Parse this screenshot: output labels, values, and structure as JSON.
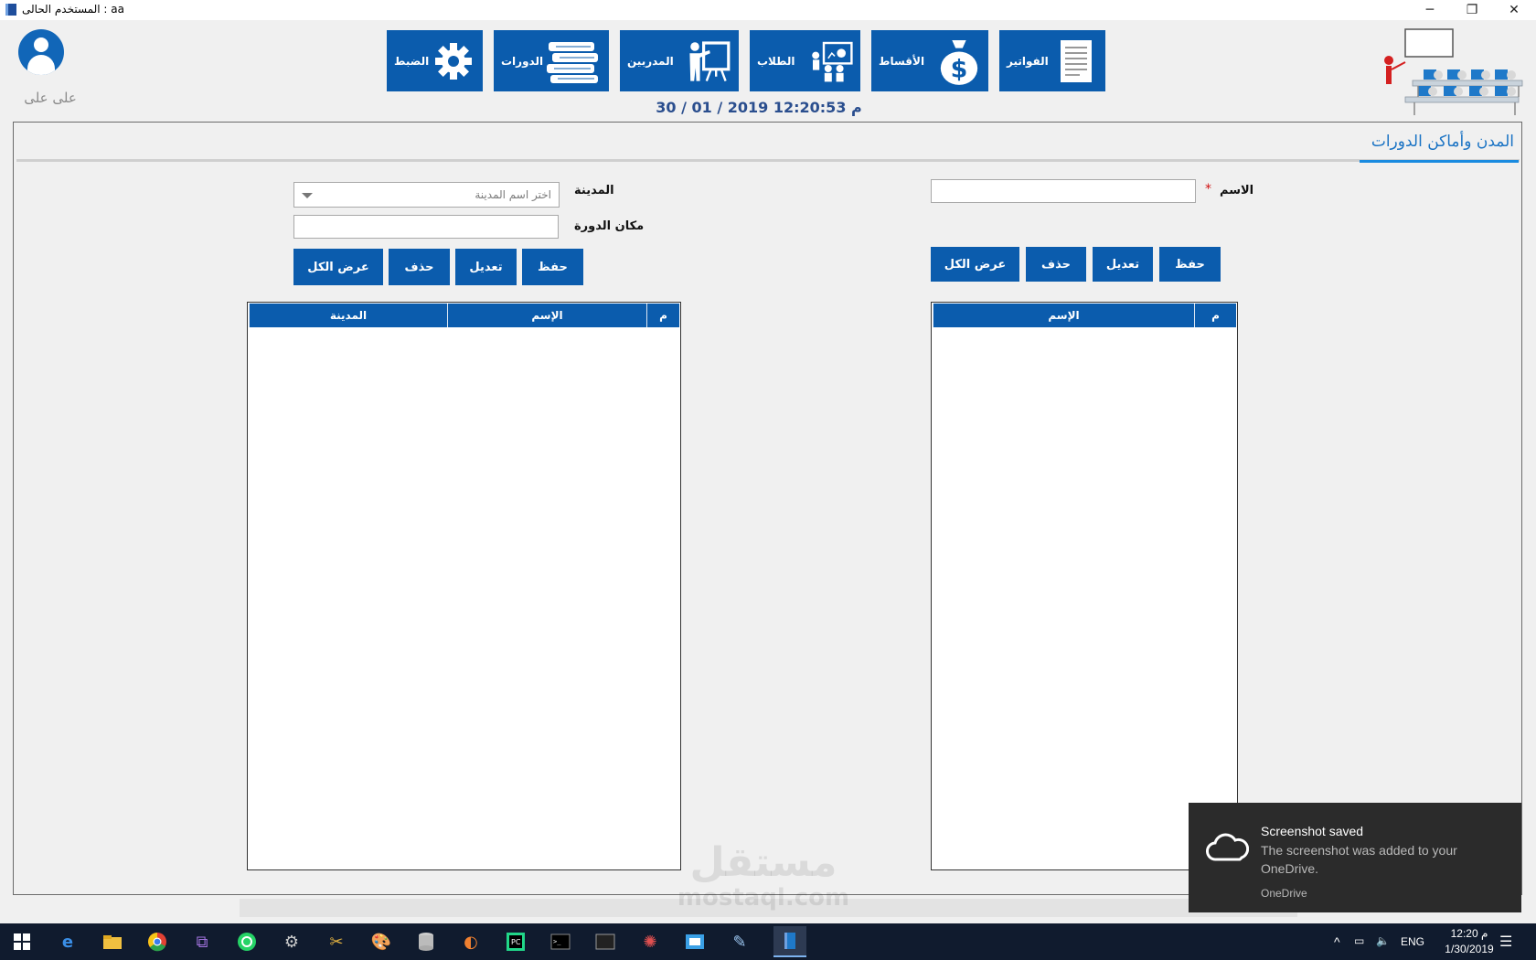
{
  "window": {
    "title": "المستخدم الحالى : aa",
    "controls": {
      "minimize": "─",
      "restore": "❐",
      "close": "✕"
    }
  },
  "user": {
    "name": "على على"
  },
  "nav": [
    {
      "id": "invoices",
      "label": "الفواتير",
      "icon": "invoice-document-icon"
    },
    {
      "id": "installments",
      "label": "الأقساط",
      "icon": "money-bag-icon"
    },
    {
      "id": "students",
      "label": "الطلاب",
      "icon": "presentation-students-icon"
    },
    {
      "id": "trainers",
      "label": "المدربين",
      "icon": "trainer-board-icon"
    },
    {
      "id": "courses",
      "label": "الدورات",
      "icon": "books-icon"
    },
    {
      "id": "settings",
      "label": "الضبط",
      "icon": "gear-icon"
    }
  ],
  "datetime": "30 / 01 / 2019   12:20:53 م",
  "page": {
    "tab_title": "المدن وأماكن الدورات"
  },
  "cities_form": {
    "name_label": "الاسم",
    "required_mark": "*",
    "name_value": "",
    "buttons": {
      "save": "حفظ",
      "edit": "تعديل",
      "delete": "حذف",
      "show_all": "عرض الكل"
    },
    "grid": {
      "columns": [
        "م",
        "الإسم"
      ],
      "rows": []
    }
  },
  "places_form": {
    "city_label": "المدينة",
    "city_placeholder": "اختر اسم المدينة",
    "place_label": "مكان الدورة",
    "place_value": "",
    "buttons": {
      "save": "حفظ",
      "edit": "تعديل",
      "delete": "حذف",
      "show_all": "عرض الكل"
    },
    "grid": {
      "columns": [
        "م",
        "الإسم",
        "المدينة"
      ],
      "rows": []
    }
  },
  "toast": {
    "title": "Screenshot saved",
    "body": "The screenshot was added to your OneDrive.",
    "source": "OneDrive"
  },
  "watermark": {
    "line1": "مستقل",
    "line2": "mostaql.com"
  },
  "taskbar": {
    "language": "ENG",
    "time": "12:20 م",
    "date": "1/30/2019"
  },
  "colors": {
    "accent": "#0b5cad",
    "tab_title": "#1a73c4",
    "datetime": "#2a4e8e"
  }
}
